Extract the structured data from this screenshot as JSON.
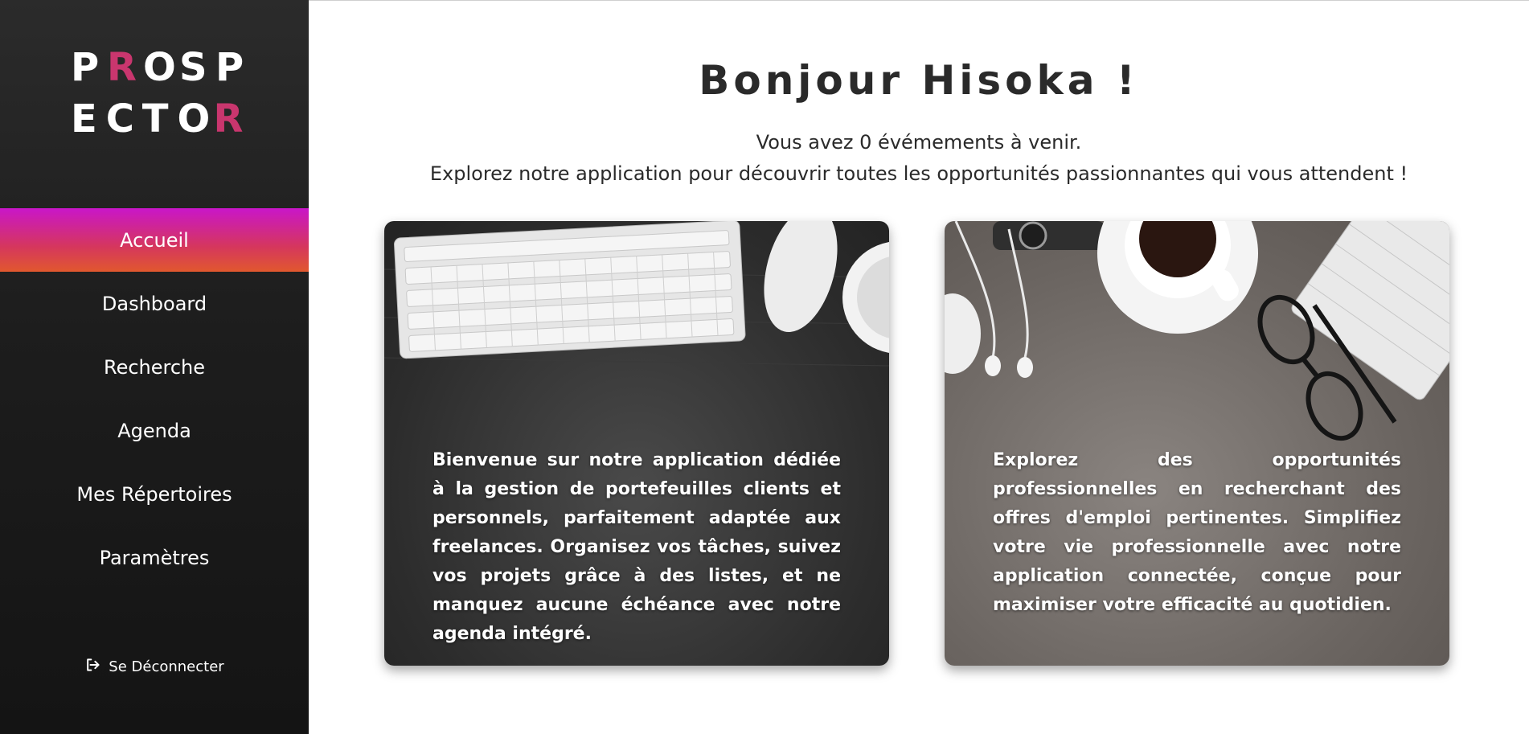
{
  "sidebar": {
    "logo_line1": [
      "P",
      "R",
      "O",
      "S",
      "P"
    ],
    "logo_line2": [
      "E",
      "C",
      "T",
      "O",
      "R"
    ],
    "items": [
      {
        "label": "Accueil"
      },
      {
        "label": "Dashboard"
      },
      {
        "label": "Recherche"
      },
      {
        "label": "Agenda"
      },
      {
        "label": "Mes Répertoires"
      },
      {
        "label": "Paramètres"
      }
    ],
    "logout_label": "Se Déconnecter",
    "logout_icon": "logout-icon"
  },
  "main": {
    "greeting": "Bonjour Hisoka !",
    "events_line": "Vous avez 0 évémements à venir.",
    "explore_line": "Explorez notre application pour découvrir toutes les opportunités passionnantes qui vous attendent !",
    "cards": [
      {
        "text": "Bienvenue sur notre application dédiée à la gestion de portefeuilles clients et personnels, parfaitement adaptée aux freelances. Organisez vos tâches, suivez vos projets grâce à des listes, et ne manquez aucune échéance avec notre agenda intégré."
      },
      {
        "text": "Explorez des opportunités professionnelles en recherchant des offres d'emploi pertinentes. Simplifiez votre vie professionnelle avec notre application connectée, conçue pour maximiser votre efficacité au quotidien."
      }
    ]
  },
  "colors": {
    "sidebar_bg": "#1d1d1d",
    "active_gradient_top": "#c916c9",
    "active_gradient_bottom": "#e1582e",
    "logo_accent": "#c9366e"
  }
}
